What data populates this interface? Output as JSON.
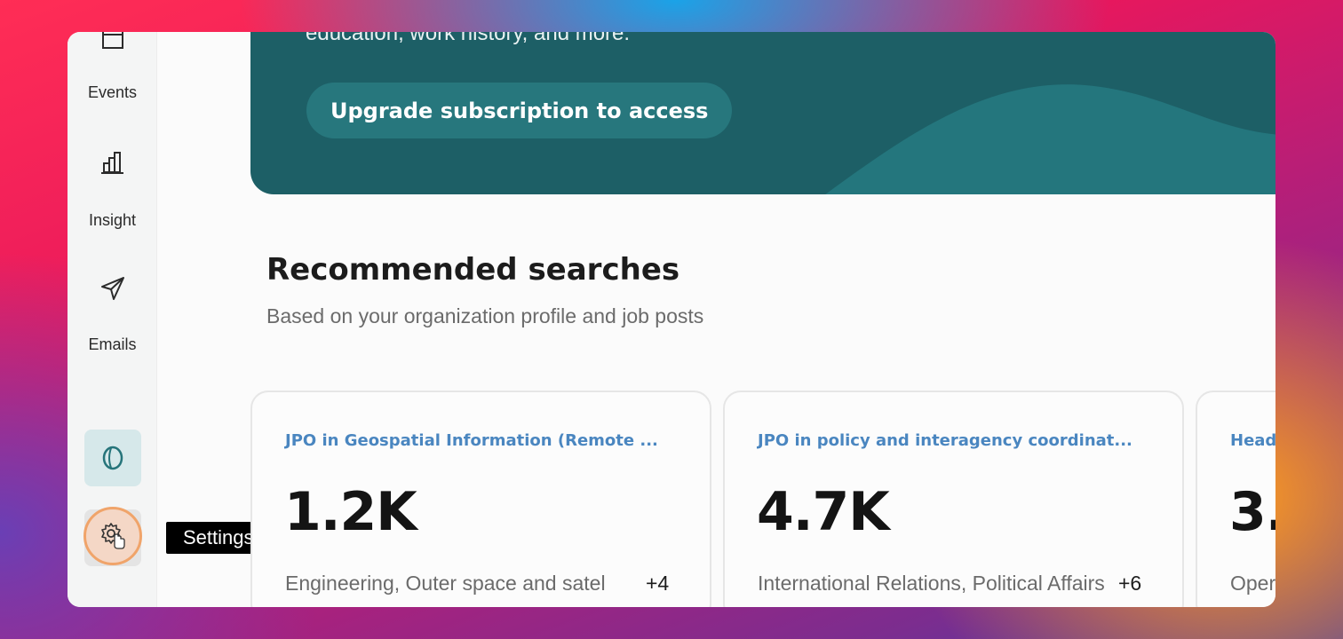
{
  "sidebar": {
    "items": [
      {
        "label": "Events",
        "icon": "calendar-icon"
      },
      {
        "label": "Insight",
        "icon": "bar-chart-icon"
      },
      {
        "label": "Emails",
        "icon": "send-icon"
      }
    ],
    "coin_icon": "coin-icon",
    "settings_icon": "gear-icon",
    "tooltip": "Settings"
  },
  "banner": {
    "text": "education, work history, and more.",
    "button_label": "Upgrade subscription to access",
    "color": "#1d5f66"
  },
  "recommended": {
    "title": "Recommended searches",
    "subtitle": "Based on your organization profile and job posts",
    "cards": [
      {
        "title": "JPO in Geospatial Information (Remote ...",
        "count": "1.2K",
        "tags": "Engineering, Outer space and satel",
        "more": "+4"
      },
      {
        "title": "JPO in policy and interagency coordinat...",
        "count": "4.7K",
        "tags": "International Relations, Political Affairs",
        "more": "+6"
      },
      {
        "title": "Head",
        "count": "3.",
        "tags": "Oper",
        "more": ""
      }
    ]
  },
  "colors": {
    "accent": "#4a86c0",
    "highlight": "#f0a46a",
    "teal": "#1d5f66"
  }
}
